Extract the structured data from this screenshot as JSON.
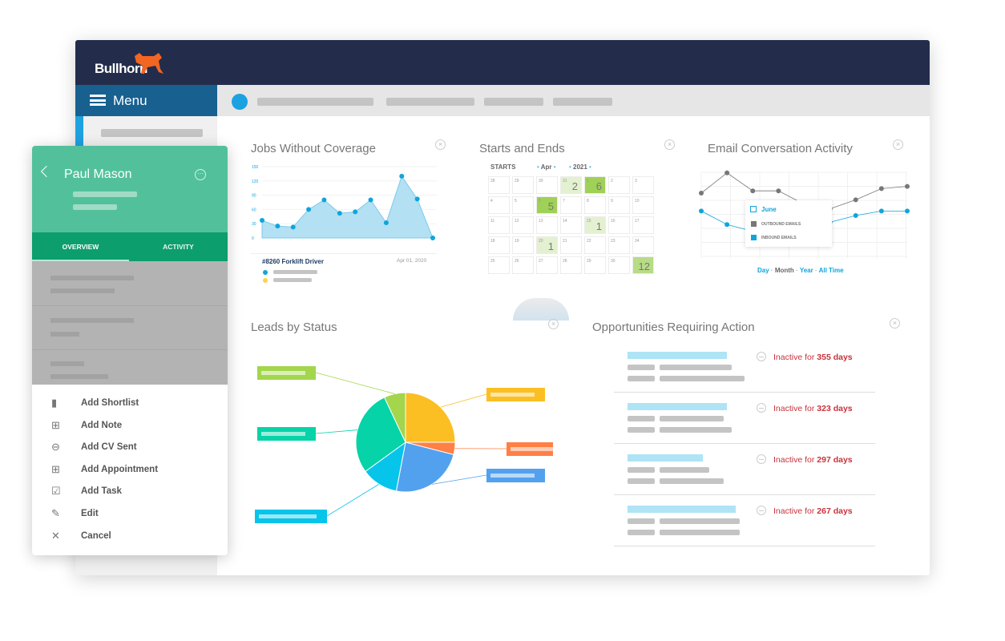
{
  "brand": {
    "name": "Bullhorn",
    "logo_color": "#f26522",
    "header_color": "#232d4b"
  },
  "sidebar": {
    "menu_label": "Menu"
  },
  "widgets": {
    "jobs": {
      "title": "Jobs Without Coverage",
      "job_label": "#8260 Forklift Driver",
      "date": "Apr 01, 2020"
    },
    "starts": {
      "title": "Starts and Ends",
      "mode": "STARTS",
      "month": "Apr",
      "year": "2021",
      "weeks": [
        [
          "28",
          "29",
          "30",
          "31",
          "1",
          "2",
          "3"
        ],
        [
          "4",
          "5",
          "6",
          "7",
          "8",
          "9",
          "10"
        ],
        [
          "11",
          "12",
          "13",
          "14",
          "15",
          "16",
          "17"
        ],
        [
          "18",
          "19",
          "20",
          "21",
          "22",
          "23",
          "24"
        ],
        [
          "25",
          "26",
          "27",
          "28",
          "29",
          "30",
          ""
        ]
      ],
      "counts": {
        "0-3": "2",
        "0-4": "6",
        "1-2": "5",
        "2-4": "1",
        "3-2": "1",
        "4-6": "12"
      },
      "strong": [
        "0-4",
        "1-2"
      ]
    },
    "email": {
      "title": "Email Conversation Activity",
      "tooltip_month": "June",
      "legend_outbound": "OUTBOUND EMAILS",
      "legend_inbound": "INBOUND EMAILS",
      "filters": [
        "Day",
        "Month",
        "Year",
        "All Time"
      ]
    },
    "leads": {
      "title": "Leads by Status"
    },
    "opps": {
      "title": "Opportunities Requiring Action",
      "items": [
        {
          "prefix": "Inactive for ",
          "days": "355 days"
        },
        {
          "prefix": "Inactive for ",
          "days": "323 days"
        },
        {
          "prefix": "Inactive for ",
          "days": "297 days"
        },
        {
          "prefix": "Inactive for ",
          "days": "267 days"
        }
      ]
    }
  },
  "card": {
    "name": "Paul Mason",
    "tabs": [
      "OVERVIEW",
      "ACTIVITY"
    ],
    "actions": [
      {
        "icon": "briefcase-icon",
        "label": "Add Shortlist"
      },
      {
        "icon": "note-add-icon",
        "label": "Add Note"
      },
      {
        "icon": "cv-sent-icon",
        "label": "Add CV Sent"
      },
      {
        "icon": "calendar-add-icon",
        "label": "Add Appointment"
      },
      {
        "icon": "task-check-icon",
        "label": "Add Task"
      },
      {
        "icon": "pencil-icon",
        "label": "Edit"
      },
      {
        "icon": "close-icon",
        "label": "Cancel"
      }
    ]
  },
  "chart_data": [
    {
      "type": "area",
      "title": "Jobs Without Coverage",
      "ylim": [
        0,
        150
      ],
      "yticks": [
        "0",
        "30",
        "60",
        "90",
        "120",
        "150"
      ],
      "values": [
        37,
        25,
        23,
        60,
        80,
        52,
        55,
        80,
        32,
        130,
        82,
        0
      ],
      "color": "#0ea5dc"
    },
    {
      "type": "line",
      "title": "Email Conversation Activity",
      "series": [
        {
          "name": "OUTBOUND EMAILS",
          "values": [
            60,
            78,
            62,
            62,
            50,
            46,
            54,
            64,
            66
          ],
          "color": "#777777"
        },
        {
          "name": "INBOUND EMAILS",
          "values": [
            44,
            32,
            26,
            28,
            34,
            34,
            40,
            44,
            44
          ],
          "color": "#0ea5dc"
        }
      ]
    },
    {
      "type": "pie",
      "title": "Leads by Status",
      "values": [
        25,
        4,
        24,
        12,
        28,
        7
      ],
      "colors": [
        "#fbbf24",
        "#ff7f45",
        "#52a1ef",
        "#06c4ea",
        "#06d3a8",
        "#a3d64c"
      ]
    }
  ]
}
